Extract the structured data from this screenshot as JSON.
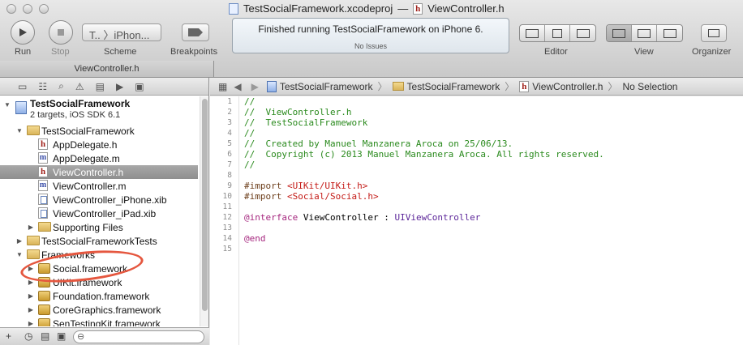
{
  "window": {
    "project_file": "TestSocialFramework.xcodeproj",
    "separator": "—",
    "open_file": "ViewController.h"
  },
  "toolbar": {
    "run_label": "Run",
    "stop_label": "Stop",
    "scheme_value": "T..  〉iPhon...",
    "scheme_label": "Scheme",
    "breakpoints_label": "Breakpoints",
    "status_main": "Finished running TestSocialFramework on iPhone 6.",
    "status_sub": "No Issues",
    "editor_label": "Editor",
    "view_label": "View",
    "organizer_label": "Organizer",
    "tab_title": "ViewController.h"
  },
  "navigator": {
    "project": {
      "name": "TestSocialFramework",
      "subtitle": "2 targets, iOS SDK 6.1"
    },
    "items": [
      {
        "label": "TestSocialFramework",
        "icon": "folder-icon",
        "indent": 1,
        "disclosure": "open"
      },
      {
        "label": "AppDelegate.h",
        "icon": "header-file-icon",
        "indent": 2
      },
      {
        "label": "AppDelegate.m",
        "icon": "implementation-file-icon",
        "indent": 2
      },
      {
        "label": "ViewController.h",
        "icon": "header-file-icon",
        "indent": 2,
        "selected": true
      },
      {
        "label": "ViewController.m",
        "icon": "implementation-file-icon",
        "indent": 2
      },
      {
        "label": "ViewController_iPhone.xib",
        "icon": "xib-file-icon",
        "indent": 2
      },
      {
        "label": "ViewController_iPad.xib",
        "icon": "xib-file-icon",
        "indent": 2
      },
      {
        "label": "Supporting Files",
        "icon": "folder-icon",
        "indent": 2,
        "disclosure": "closed"
      },
      {
        "label": "TestSocialFrameworkTests",
        "icon": "folder-icon",
        "indent": 1,
        "disclosure": "closed"
      },
      {
        "label": "Frameworks",
        "icon": "folder-icon",
        "indent": 1,
        "disclosure": "open"
      },
      {
        "label": "Social.framework",
        "icon": "framework-icon",
        "indent": 2,
        "disclosure": "closed"
      },
      {
        "label": "UIKit.framework",
        "icon": "framework-icon",
        "indent": 2,
        "disclosure": "closed"
      },
      {
        "label": "Foundation.framework",
        "icon": "framework-icon",
        "indent": 2,
        "disclosure": "closed"
      },
      {
        "label": "CoreGraphics.framework",
        "icon": "framework-icon",
        "indent": 2,
        "disclosure": "closed"
      },
      {
        "label": "SenTestingKit.framework",
        "icon": "framework-icon",
        "indent": 2,
        "disclosure": "closed"
      }
    ]
  },
  "jumpbar": {
    "crumbs": [
      "TestSocialFramework",
      "TestSocialFramework",
      "ViewController.h"
    ],
    "selection": "No Selection"
  },
  "editor": {
    "lines": [
      [
        [
          "c-com",
          "//"
        ]
      ],
      [
        [
          "c-com",
          "//  ViewController.h"
        ]
      ],
      [
        [
          "c-com",
          "//  TestSocialFramework"
        ]
      ],
      [
        [
          "c-com",
          "//"
        ]
      ],
      [
        [
          "c-com",
          "//  Created by Manuel Manzanera Aroca on 25/06/13."
        ]
      ],
      [
        [
          "c-com",
          "//  Copyright (c) 2013 Manuel Manzanera Aroca. All rights reserved."
        ]
      ],
      [
        [
          "c-com",
          "//"
        ]
      ],
      [],
      [
        [
          "c-pre",
          "#import "
        ],
        [
          "c-str",
          "<UIKit/UIKit.h>"
        ]
      ],
      [
        [
          "c-pre",
          "#import "
        ],
        [
          "c-str",
          "<Social/Social.h>"
        ]
      ],
      [],
      [
        [
          "c-kw",
          "@interface"
        ],
        [
          "",
          " ViewController : "
        ],
        [
          "c-cls",
          "UIViewController"
        ]
      ],
      [],
      [
        [
          "c-kw",
          "@end"
        ]
      ],
      []
    ]
  },
  "colors": {
    "annotation_circle": "#e5573f",
    "selected_row": "#8e8e8e",
    "comment": "#2a8a1d",
    "keyword": "#a6287f"
  }
}
